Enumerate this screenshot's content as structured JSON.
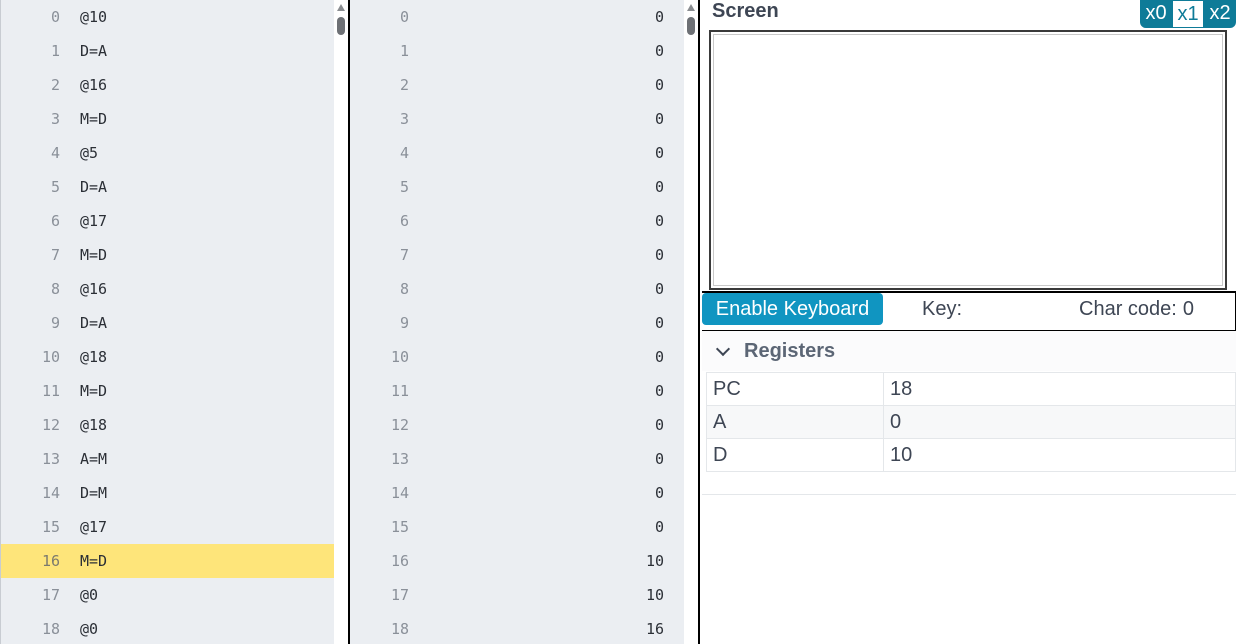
{
  "rom": {
    "rows": [
      {
        "index": "0",
        "instruction": "@10"
      },
      {
        "index": "1",
        "instruction": "D=A"
      },
      {
        "index": "2",
        "instruction": "@16"
      },
      {
        "index": "3",
        "instruction": "M=D"
      },
      {
        "index": "4",
        "instruction": "@5"
      },
      {
        "index": "5",
        "instruction": "D=A"
      },
      {
        "index": "6",
        "instruction": "@17"
      },
      {
        "index": "7",
        "instruction": "M=D"
      },
      {
        "index": "8",
        "instruction": "@16"
      },
      {
        "index": "9",
        "instruction": "D=A"
      },
      {
        "index": "10",
        "instruction": "@18"
      },
      {
        "index": "11",
        "instruction": "M=D"
      },
      {
        "index": "12",
        "instruction": "@18"
      },
      {
        "index": "13",
        "instruction": "A=M"
      },
      {
        "index": "14",
        "instruction": "D=M"
      },
      {
        "index": "15",
        "instruction": "@17"
      },
      {
        "index": "16",
        "instruction": "M=D"
      },
      {
        "index": "17",
        "instruction": "@0"
      },
      {
        "index": "18",
        "instruction": "@0"
      }
    ],
    "highlighted_index": "16",
    "highlight_color": "#fee57a"
  },
  "ram": {
    "rows": [
      {
        "index": "0",
        "value": "0"
      },
      {
        "index": "1",
        "value": "0"
      },
      {
        "index": "2",
        "value": "0"
      },
      {
        "index": "3",
        "value": "0"
      },
      {
        "index": "4",
        "value": "0"
      },
      {
        "index": "5",
        "value": "0"
      },
      {
        "index": "6",
        "value": "0"
      },
      {
        "index": "7",
        "value": "0"
      },
      {
        "index": "8",
        "value": "0"
      },
      {
        "index": "9",
        "value": "0"
      },
      {
        "index": "10",
        "value": "0"
      },
      {
        "index": "11",
        "value": "0"
      },
      {
        "index": "12",
        "value": "0"
      },
      {
        "index": "13",
        "value": "0"
      },
      {
        "index": "14",
        "value": "0"
      },
      {
        "index": "15",
        "value": "0"
      },
      {
        "index": "16",
        "value": "10"
      },
      {
        "index": "17",
        "value": "10"
      },
      {
        "index": "18",
        "value": "16"
      }
    ]
  },
  "screen": {
    "title": "Screen",
    "zoom_options": [
      "x0",
      "x1",
      "x2"
    ],
    "active_zoom": "x1"
  },
  "keyboard": {
    "enable_label": "Enable Keyboard",
    "key_label": "Key:",
    "charcode_label": "Char code:",
    "charcode_value": "0"
  },
  "registers": {
    "title": "Registers",
    "rows": [
      {
        "name": "PC",
        "value": "18"
      },
      {
        "name": "A",
        "value": "0"
      },
      {
        "name": "D",
        "value": "10"
      }
    ]
  },
  "colors": {
    "accent": "#1095c1",
    "zoom_accent": "#0e7b98",
    "panel_bg": "#ebeef2"
  },
  "icons": {
    "scroll_up": "scroll-up-arrow-icon",
    "registers_toggle": "chevron-down-icon"
  }
}
